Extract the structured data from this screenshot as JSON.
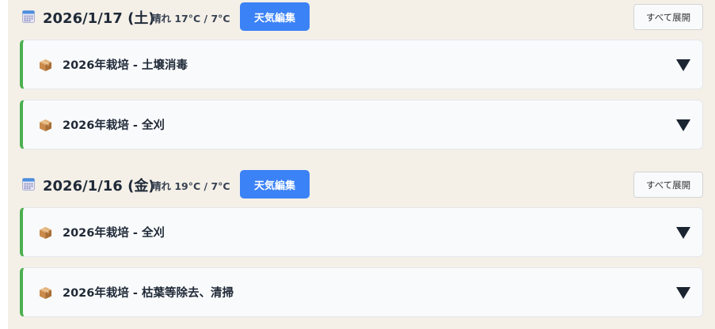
{
  "days": [
    {
      "date": "2026/1/17 (土)",
      "weather": "晴れ 17°C / 7°C",
      "weather_edit_label": "天気編集",
      "expand_all_label": "すべて展開",
      "tasks": [
        {
          "title": "2026年栽培 - 土壌消毒"
        },
        {
          "title": "2026年栽培 - 全刈"
        }
      ]
    },
    {
      "date": "2026/1/16 (金)",
      "weather": "晴れ 19°C / 7°C",
      "weather_edit_label": "天気編集",
      "expand_all_label": "すべて展開",
      "tasks": [
        {
          "title": "2026年栽培 - 全刈"
        },
        {
          "title": "2026年栽培 - 枯葉等除去、清掃"
        }
      ]
    }
  ],
  "icons": {
    "date": "calendar-icon",
    "task": "package-icon",
    "expand": "triangle-down-icon"
  },
  "colors": {
    "accent": "#3b82f6",
    "task_border": "#4caf50",
    "panel_background": "#f4f0e8"
  }
}
